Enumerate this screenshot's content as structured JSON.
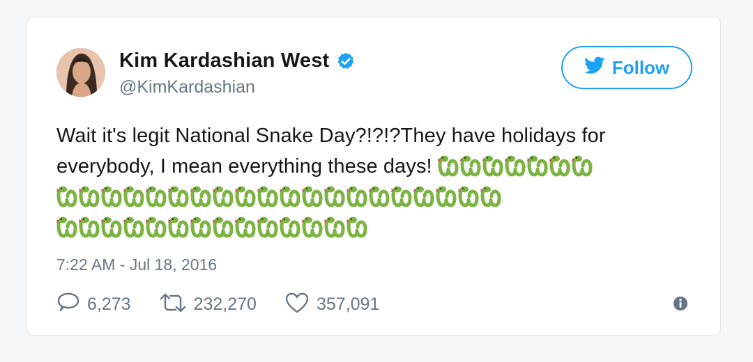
{
  "tweet": {
    "display_name": "Kim Kardashian West",
    "handle": "@KimKardashian",
    "follow_label": "Follow",
    "text_line1": "Wait it's legit National Snake Day?!?!?They have holidays for",
    "text_line2": "everybody, I mean everything these days!",
    "snake_counts": [
      7,
      20,
      14
    ],
    "timestamp": "7:22 AM - Jul 18, 2016",
    "replies": "6,273",
    "retweets": "232,270",
    "likes": "357,091"
  },
  "icons": {
    "verified": "verified-badge-icon",
    "bird": "twitter-bird-icon",
    "reply": "reply-icon",
    "retweet": "retweet-icon",
    "like": "heart-icon",
    "info": "info-icon",
    "snake": "snake-emoji"
  },
  "colors": {
    "accent": "#1da1f2",
    "secondary_text": "#657786",
    "snake_green": "#7cb342"
  }
}
